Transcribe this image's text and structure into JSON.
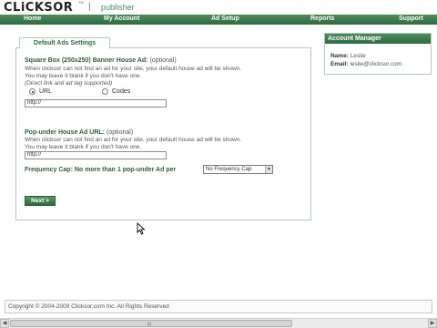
{
  "header": {
    "logo_text": "CLiCKSOR",
    "logo_tm": "TM",
    "separator": "|",
    "subtitle": "publisher"
  },
  "nav": {
    "items": [
      {
        "label": "Home"
      },
      {
        "label": "My Account"
      },
      {
        "label": "Ad Setup"
      },
      {
        "label": "Reports"
      },
      {
        "label": "Support"
      }
    ]
  },
  "main": {
    "tab_label": "Default Ads Settings",
    "banner_section": {
      "title": "Square Box (250x250) Banner House Ad:",
      "optional": "(optional)",
      "desc1": "When clicksor can not find an ad for your site, your default house ad will be shown.",
      "desc2": "You may leave it blank if you don't have one.",
      "desc3": "(Direct link and ad tag supported)",
      "radio_url_label": "URL",
      "radio_codes_label": "Codes",
      "url_value": "http://"
    },
    "popunder_section": {
      "title": "Pop-under House Ad URL:",
      "optional": "(optional)",
      "desc1": "When clicksor can not find an ad for your site, your default house ad will be shown.",
      "desc2": "You may leave it blank if you don't have one.",
      "url_value": "http://"
    },
    "frequency": {
      "label": "Frequency Cap: No more than 1 pop-under Ad per",
      "selected": "No Frequency Cap"
    },
    "next_button": "Next >"
  },
  "account_manager": {
    "title": "Account Manager",
    "name_label": "Name:",
    "name_value": "Leslie",
    "email_label": "Email:",
    "email_value": "leslie@clicksor.com"
  },
  "footer": {
    "copyright": "Copyright © 2004-2009 Clicksor.com Inc. All Rights Reserved"
  },
  "scrollbar": {
    "left_arrow": "◀",
    "right_arrow": "▶",
    "grip": "|||"
  },
  "colors": {
    "brand_green": "#2f6a3e",
    "accent_text": "#2d5e3a"
  }
}
